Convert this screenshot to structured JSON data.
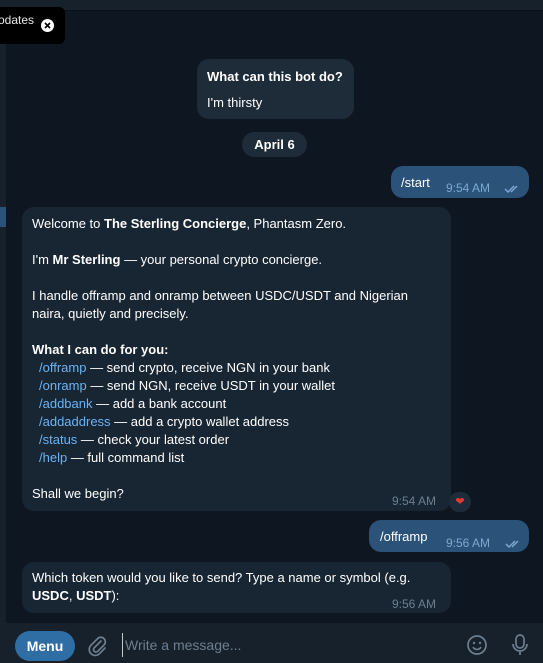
{
  "toast": {
    "text": "odates"
  },
  "service_message": {
    "question": "What can this bot do?",
    "answer": "I'm thirsty"
  },
  "date_separator": "April 6",
  "messages": {
    "start": {
      "text": "/start",
      "time": "9:54 AM"
    },
    "welcome": {
      "line1_pre": "Welcome to ",
      "line1_bold": "The Sterling Concierge",
      "line1_post": ", Phantasm Zero.",
      "line2_pre": "I'm ",
      "line2_bold": "Mr Sterling",
      "line2_post": " — your personal crypto concierge.",
      "line3a": "I handle offramp and onramp between USDC/USDT and Nigerian",
      "line3b": "naira, quietly and precisely.",
      "heading": "What I can do for you:",
      "commands": [
        {
          "cmd": "/offramp",
          "desc": " — send crypto, receive NGN in your bank"
        },
        {
          "cmd": "/onramp",
          "desc": " — send NGN, receive USDT in your wallet"
        },
        {
          "cmd": "/addbank",
          "desc": " — add a bank account"
        },
        {
          "cmd": "/addaddress",
          "desc": " — add a crypto wallet address"
        },
        {
          "cmd": "/status",
          "desc": " — check your latest order"
        },
        {
          "cmd": "/help",
          "desc": " — full command list"
        }
      ],
      "closing": "Shall we begin?",
      "time": "9:54 AM",
      "reaction": "❤"
    },
    "offramp": {
      "text": "/offramp",
      "time": "9:56 AM"
    },
    "token_prompt": {
      "line1": "Which token would you like to send? Type a name or symbol (e.g.",
      "bold1": "USDC",
      "sep": ", ",
      "bold2": "USDT",
      "end": "):",
      "time": "9:56 AM"
    }
  },
  "composer": {
    "menu_label": "Menu",
    "placeholder": "Write a message..."
  },
  "icons": {
    "close": "close-icon",
    "ticks": "double-check-icon",
    "clip": "paperclip-icon",
    "emoji": "emoji-icon",
    "mic": "microphone-icon",
    "heart": "heart-icon"
  },
  "colors": {
    "background": "#0e1621",
    "incoming": "#182533",
    "outgoing": "#2b5278",
    "link": "#6ab3f3",
    "menu": "#2f6ea5"
  }
}
